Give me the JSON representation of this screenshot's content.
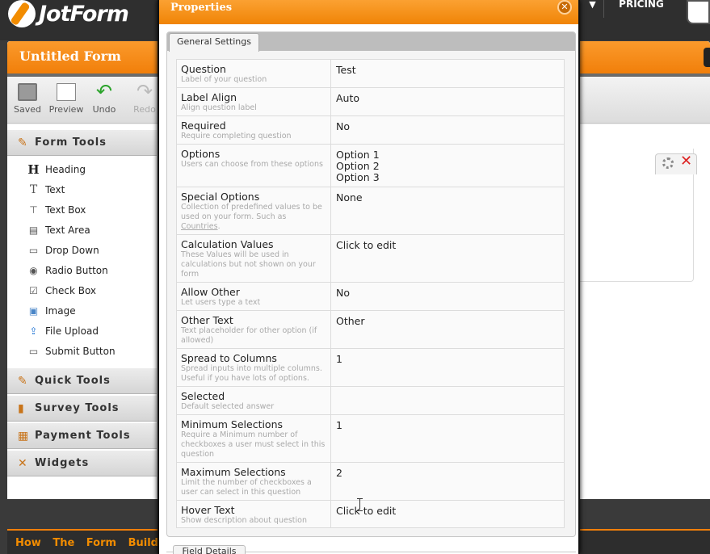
{
  "topbar": {
    "logo_text": "JotForm",
    "caret": "▼",
    "pricing_label": "PRICING"
  },
  "builder": {
    "form_title": "Untitled Form",
    "toolbar": {
      "saved_label": "Saved",
      "preview_label": "Preview",
      "undo_label": "Undo",
      "redo_label": "Redo"
    },
    "form_tools": {
      "header": "Form Tools",
      "items": [
        {
          "label": "Heading",
          "icon": "heading-icon",
          "glyph": "H"
        },
        {
          "label": "Text",
          "icon": "text-icon",
          "glyph": "T"
        },
        {
          "label": "Text Box",
          "icon": "textbox-icon",
          "glyph": "⊤"
        },
        {
          "label": "Text Area",
          "icon": "textarea-icon",
          "glyph": "▤"
        },
        {
          "label": "Drop Down",
          "icon": "dropdown-icon",
          "glyph": "▭"
        },
        {
          "label": "Radio Button",
          "icon": "radio-icon",
          "glyph": "◉"
        },
        {
          "label": "Check Box",
          "icon": "checkbox-icon",
          "glyph": "☑"
        },
        {
          "label": "Image",
          "icon": "image-icon",
          "glyph": "▣"
        },
        {
          "label": "File Upload",
          "icon": "upload-icon",
          "glyph": "⇪"
        },
        {
          "label": "Submit Button",
          "icon": "submit-icon",
          "glyph": "▭"
        }
      ]
    },
    "sections": [
      {
        "label": "Quick Tools",
        "icon": "wand-icon",
        "glyph": "✎"
      },
      {
        "label": "Survey Tools",
        "icon": "bar-chart-icon",
        "glyph": "▮"
      },
      {
        "label": "Payment Tools",
        "icon": "payment-icon",
        "glyph": "▦"
      },
      {
        "label": "Widgets",
        "icon": "widgets-icon",
        "glyph": "✕"
      }
    ],
    "bottom_link": "How The Form Builder Works"
  },
  "modal": {
    "title": "Properties",
    "close_glyph": "✕",
    "tab_general": "General Settings",
    "tab_field_details": "Field Details",
    "properties": [
      {
        "label": "Question",
        "desc": "Label of your question",
        "value": [
          "Test"
        ]
      },
      {
        "label": "Label Align",
        "desc": "Align question label",
        "value": [
          "Auto"
        ]
      },
      {
        "label": "Required",
        "desc": "Require completing question",
        "value": [
          "No"
        ]
      },
      {
        "label": "Options",
        "desc": "Users can choose from these options",
        "value": [
          "Option 1",
          "Option 2",
          "Option 3"
        ]
      },
      {
        "label": "Special Options",
        "desc": "Collection of predefined values to be used on your form. Such as",
        "desc_link": "Countries",
        "value": [
          "None"
        ]
      },
      {
        "label": "Calculation Values",
        "desc": "These Values will be used in calculations but not shown on your form",
        "value": [
          "Click to edit"
        ]
      },
      {
        "label": "Allow Other",
        "desc": "Let users type a text",
        "value": [
          "No"
        ]
      },
      {
        "label": "Other Text",
        "desc": "Text placeholder for other option (if allowed)",
        "value": [
          "Other"
        ]
      },
      {
        "label": "Spread to Columns",
        "desc": "Spread inputs into multiple columns. Useful if you have lots of options.",
        "value": [
          "1"
        ]
      },
      {
        "label": "Selected",
        "desc": "Default selected answer",
        "value": [
          ""
        ]
      },
      {
        "label": "Minimum Selections",
        "desc": "Require a Minimum number of checkboxes a user must select in this question",
        "value": [
          "1"
        ]
      },
      {
        "label": "Maximum Selections",
        "desc": "Limit the number of checkboxes a user can select in this question",
        "value": [
          "2"
        ]
      },
      {
        "label": "Hover Text",
        "desc": "Show description about question",
        "value": [
          "Click to edit"
        ]
      }
    ]
  },
  "colors": {
    "accent": "#f28c00",
    "dark_bg": "#2f2f2f"
  }
}
